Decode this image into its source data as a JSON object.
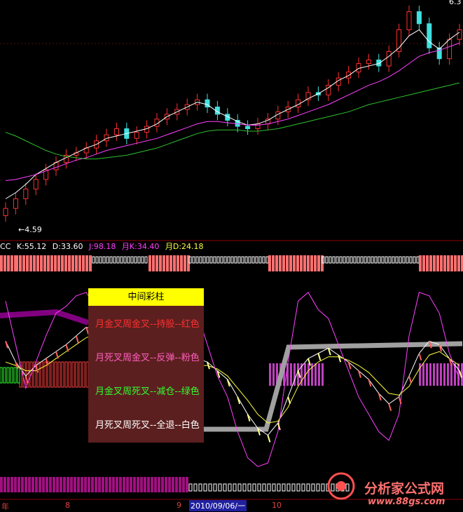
{
  "chart_data": [
    {
      "type": "candlestick",
      "panel": "price",
      "price_low_label": "4.59",
      "price_high_label": "6.3",
      "series": [
        {
          "name": "close",
          "values": [
            4.72,
            4.8,
            4.88,
            4.96,
            5.04,
            5.1,
            5.16,
            5.18,
            5.22,
            5.28,
            5.33,
            5.38,
            5.3,
            5.35,
            5.4,
            5.46,
            5.5,
            5.54,
            5.58,
            5.62,
            5.56,
            5.5,
            5.45,
            5.4,
            5.38,
            5.42,
            5.46,
            5.52,
            5.56,
            5.62,
            5.68,
            5.66,
            5.74,
            5.8,
            5.85,
            5.92,
            5.95,
            5.9,
            6.02,
            6.2,
            6.35,
            6.25,
            6.05,
            5.96,
            6.12,
            6.2
          ]
        },
        {
          "name": "MA-short",
          "values": [
            4.8,
            4.85,
            4.92,
            5.0,
            5.05,
            5.1,
            5.14,
            5.18,
            5.22,
            5.25,
            5.3,
            5.32,
            5.34,
            5.36,
            5.38,
            5.42,
            5.48,
            5.52,
            5.56,
            5.6,
            5.58,
            5.52,
            5.48,
            5.44,
            5.41,
            5.42,
            5.45,
            5.5,
            5.54,
            5.58,
            5.63,
            5.67,
            5.72,
            5.78,
            5.82,
            5.88,
            5.9,
            5.92,
            5.98,
            6.05,
            6.15,
            6.2,
            6.1,
            6.04,
            6.12,
            6.18
          ]
        },
        {
          "name": "MA-mid",
          "values": [
            4.95,
            4.96,
            4.98,
            5.0,
            5.03,
            5.06,
            5.09,
            5.12,
            5.14,
            5.17,
            5.2,
            5.22,
            5.24,
            5.26,
            5.28,
            5.3,
            5.33,
            5.36,
            5.39,
            5.42,
            5.44,
            5.44,
            5.43,
            5.42,
            5.41,
            5.41,
            5.42,
            5.44,
            5.46,
            5.49,
            5.52,
            5.55,
            5.58,
            5.62,
            5.66,
            5.7,
            5.74,
            5.77,
            5.81,
            5.86,
            5.92,
            5.98,
            6.01,
            6.03,
            6.06,
            6.09
          ]
        },
        {
          "name": "MA-long",
          "values": [
            5.35,
            5.32,
            5.28,
            5.24,
            5.2,
            5.17,
            5.15,
            5.14,
            5.13,
            5.13,
            5.14,
            5.15,
            5.16,
            5.18,
            5.2,
            5.22,
            5.25,
            5.28,
            5.31,
            5.34,
            5.36,
            5.37,
            5.37,
            5.37,
            5.36,
            5.36,
            5.37,
            5.38,
            5.4,
            5.42,
            5.44,
            5.46,
            5.48,
            5.5,
            5.52,
            5.55,
            5.58,
            5.6,
            5.62,
            5.64,
            5.66,
            5.68,
            5.7,
            5.72,
            5.74,
            5.76
          ]
        }
      ],
      "ylim": [
        4.5,
        6.4
      ]
    },
    {
      "type": "line",
      "panel": "indicator",
      "indicator_values": {
        "name": "CC",
        "K": "55.12",
        "D": "33.60",
        "J": "98.18",
        "MK": "34.40",
        "MD": "24.18"
      },
      "series": [
        {
          "name": "K",
          "values": [
            72,
            60,
            52,
            58,
            62,
            66,
            70,
            75,
            80,
            78,
            70,
            60,
            52,
            45,
            40,
            38,
            42,
            50,
            58,
            62,
            60,
            55,
            50,
            40,
            30,
            22,
            18,
            25,
            40,
            55,
            62,
            65,
            68,
            64,
            60,
            55,
            50,
            42,
            36,
            40,
            52,
            65,
            72,
            70,
            62,
            55
          ]
        },
        {
          "name": "D",
          "values": [
            60,
            58,
            55,
            55,
            58,
            62,
            66,
            70,
            74,
            76,
            72,
            66,
            58,
            50,
            45,
            42,
            43,
            48,
            54,
            58,
            58,
            56,
            52,
            45,
            38,
            30,
            25,
            26,
            34,
            46,
            55,
            60,
            63,
            63,
            61,
            58,
            54,
            48,
            42,
            41,
            46,
            56,
            64,
            66,
            62,
            58
          ]
        },
        {
          "name": "J",
          "values": [
            95,
            70,
            45,
            60,
            75,
            88,
            92,
            98,
            100,
            90,
            70,
            45,
            30,
            20,
            15,
            22,
            35,
            58,
            78,
            88,
            70,
            52,
            40,
            20,
            5,
            0,
            2,
            20,
            60,
            95,
            100,
            90,
            85,
            70,
            55,
            40,
            30,
            20,
            15,
            30,
            75,
            100,
            98,
            88,
            65,
            50
          ]
        }
      ],
      "ylim": [
        -10,
        110
      ]
    }
  ],
  "labels": {
    "low": "4.59",
    "high": "6.3"
  },
  "indicator_header": {
    "name": "CC",
    "k": "K:55.12",
    "d": "D:33.60",
    "j": "J:98.18",
    "mk": "月K:34.40",
    "md": "月D:24.18"
  },
  "legend": {
    "title": "中间彩柱",
    "rows": [
      {
        "text": "月金叉周金叉--持股--红色",
        "color": "#ff3030"
      },
      {
        "text": "月死叉周金叉--反弹--粉色",
        "color": "#ff60c0"
      },
      {
        "text": "月金叉周死叉--减仓--绿色",
        "color": "#30ff30"
      },
      {
        "text": "月死叉周死叉--全退--白色",
        "color": "#ffffff"
      }
    ]
  },
  "x_axis": {
    "labels": [
      "年",
      "8",
      "9",
      "10"
    ],
    "highlight_date": "2010/09/06/一"
  },
  "watermark": {
    "text": "分析家公式网",
    "url": "www.88gs.com"
  },
  "colors": {
    "up": "#ff3030",
    "down": "#40e0e0",
    "ma_short": "#ffffff",
    "ma_mid": "#ff40ff",
    "ma_long": "#30c030",
    "k": "#ffffff",
    "d": "#ffff40",
    "j": "#ff40ff",
    "header_cc": "#ffffff",
    "header_j": "#ff40ff",
    "header_mk": "#ff40ff",
    "header_md": "#ffff40"
  }
}
